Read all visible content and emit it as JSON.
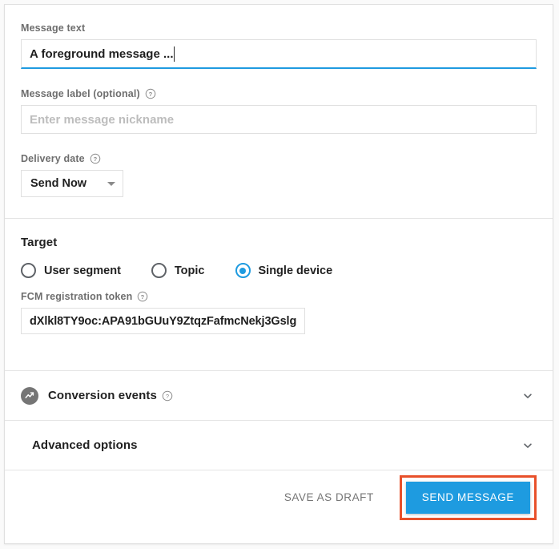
{
  "theme": {
    "accent_blue": "#1e9be0",
    "highlight_orange": "#e8502a",
    "label_gray": "#6e6e6e",
    "text_dark": "#212121",
    "border_gray": "#e0e0e0"
  },
  "compose": {
    "message_text": {
      "label": "Message text",
      "value": "A foreground message ...",
      "focused": true
    },
    "message_label": {
      "label": "Message label (optional)",
      "help_icon": "help-circle-icon",
      "placeholder": "Enter message nickname",
      "value": ""
    },
    "delivery_date": {
      "label": "Delivery date",
      "help_icon": "help-circle-icon",
      "selected": "Send Now",
      "options": [
        "Send Now"
      ]
    }
  },
  "target": {
    "title": "Target",
    "options": [
      {
        "label": "User segment",
        "selected": false
      },
      {
        "label": "Topic",
        "selected": false
      },
      {
        "label": "Single device",
        "selected": true
      }
    ],
    "token_field": {
      "label": "FCM registration token",
      "help_icon": "help-circle-icon",
      "value": "dXlkl8TY9oc:APA91bGUuY9ZtqzFafmcNekj3Gslg"
    }
  },
  "accordions": [
    {
      "title": "Conversion events",
      "leading_icon": "analytics-circle-icon",
      "help_icon": "help-circle-icon",
      "chevron": "chevron-down-icon",
      "expanded": false
    },
    {
      "title": "Advanced options",
      "leading_icon": null,
      "help_icon": null,
      "chevron": "chevron-down-icon",
      "expanded": false
    }
  ],
  "footer": {
    "save_draft_label": "SAVE AS DRAFT",
    "send_message_label": "SEND MESSAGE",
    "send_highlighted": true
  }
}
